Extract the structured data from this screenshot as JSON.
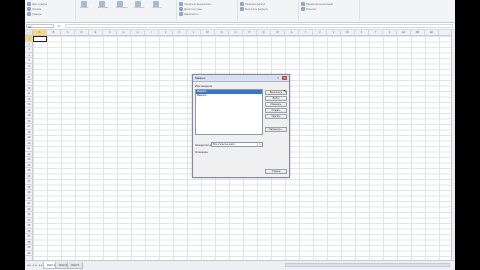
{
  "ribbon": {
    "groups": [
      {
        "label": "",
        "items": [
          "Цвет шрифта",
          "Заливка",
          "Границы"
        ]
      },
      {
        "label": "",
        "items": [
          "Создать из выделенного",
          "Диспетчер имен",
          "Зависимости"
        ]
      },
      {
        "label": "",
        "items": [
          "Проверка формул",
          "Вычислить формулу"
        ]
      },
      {
        "label": "",
        "items": [
          "Параметры вычислений",
          "Пересчет"
        ]
      }
    ],
    "big_buttons": [
      "Вставить",
      "Автосумма",
      "Финансовые",
      "Логические",
      "Текстовые"
    ]
  },
  "formula_bar": {
    "name_box": "A1",
    "fx": "fx",
    "content": ""
  },
  "columns": [
    "A",
    "B",
    "C",
    "D",
    "E",
    "F",
    "G",
    "H",
    "I",
    "J",
    "K",
    "L",
    "M",
    "N",
    "O",
    "P",
    "Q",
    "R",
    "S",
    "T",
    "U",
    "V",
    "W",
    "X",
    "Y",
    "Z",
    "AA",
    "AB",
    "AC"
  ],
  "rows": [
    "1",
    "2",
    "3",
    "4",
    "5",
    "6",
    "7",
    "8",
    "9",
    "10",
    "11",
    "12",
    "13",
    "14",
    "15",
    "16",
    "17",
    "18",
    "19",
    "20",
    "21",
    "22",
    "23",
    "24",
    "25",
    "26",
    "27",
    "28",
    "29",
    "30",
    "31",
    "32",
    "33",
    "34",
    "35",
    "36",
    "37",
    "38",
    "39",
    "40"
  ],
  "sheet_tabs": [
    "Лист1",
    "Лист2",
    "Лист3"
  ],
  "active_tab": "Лист1",
  "dialog": {
    "title": "Макрос",
    "name_label": "Имя макроса:",
    "list_items": [
      "Макрос1",
      "Макрос2"
    ],
    "selected_item": "Макрос1",
    "buttons": [
      "Выполнить",
      "Войти",
      "Изменить",
      "Создать",
      "Удалить",
      "Параметры...",
      "Отмена"
    ],
    "location_label": "Находится в:",
    "location_value": "Все открытые книги",
    "description_label": "Описание"
  },
  "colors": {
    "accent": "#3476d0",
    "title_bar": "#d6e2f2",
    "close": "#c94c3f",
    "selection": "#f8d77a"
  }
}
